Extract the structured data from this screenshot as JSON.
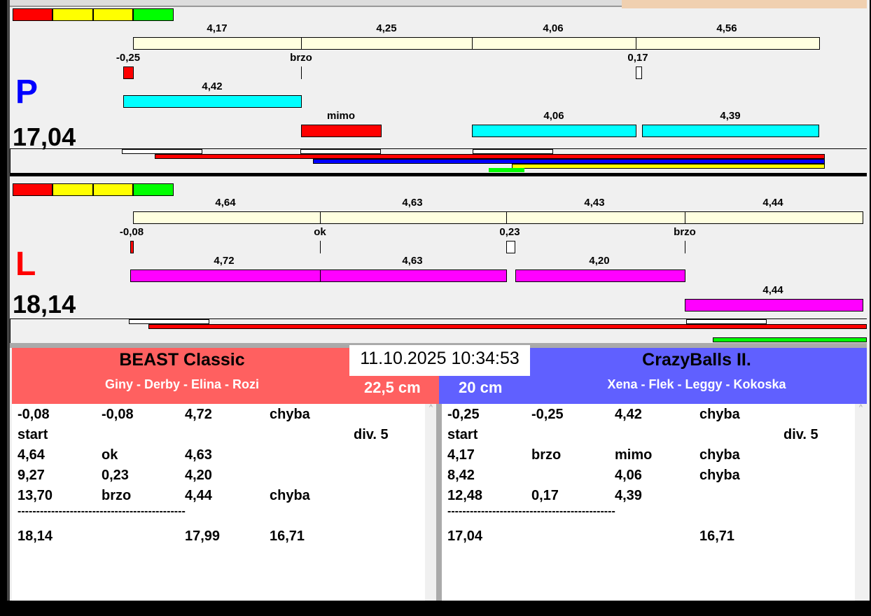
{
  "colors": {
    "red": "#ff0000",
    "yellow": "#ffff00",
    "green": "#00ff00",
    "cream": "#ffffe0",
    "cyan": "#00ffff",
    "magenta": "#ff00ff",
    "blue": "#0000ff",
    "team_left": "#ff6060",
    "team_right": "#6060ff"
  },
  "panel_p": {
    "letter": "P",
    "total": "17,04",
    "top_labels": [
      "4,17",
      "4,25",
      "4,06",
      "4,56"
    ],
    "mid_labels": [
      "-0,25",
      "brzo",
      "0,17"
    ],
    "cyan1_label": "4,42",
    "row2_labels": [
      "mimo",
      "4,06",
      "4,39"
    ]
  },
  "panel_l": {
    "letter": "L",
    "total": "18,14",
    "top_labels": [
      "4,64",
      "4,63",
      "4,43",
      "4,44"
    ],
    "mid_labels": [
      "-0,08",
      "ok",
      "0,23",
      "brzo"
    ],
    "mag_labels": [
      "4,72",
      "4,63",
      "4,20"
    ],
    "mag2_label": "4,44"
  },
  "datetime": "11.10.2025 10:34:53",
  "left_team": {
    "name": "BEAST Classic",
    "members": "Giny - Derby - Elina - Rozi",
    "distance": "22,5 cm",
    "rows": [
      [
        "-0,08",
        "-0,08",
        "4,72",
        "chyba",
        ""
      ],
      [
        "start",
        "",
        "",
        "",
        "div.  5"
      ],
      [
        "4,64",
        "ok",
        "4,63",
        "",
        ""
      ],
      [
        "9,27",
        "0,23",
        "4,20",
        "",
        ""
      ],
      [
        "13,70",
        "brzo",
        "4,44",
        "chyba",
        ""
      ]
    ],
    "divider": "---------------------------------------------",
    "totals": [
      "18,14",
      "",
      "17,99",
      "16,71",
      ""
    ]
  },
  "right_team": {
    "name": "CrazyBalls II.",
    "members": "Xena - Flek - Leggy - Kokoska",
    "distance": "20 cm",
    "rows": [
      [
        "-0,25",
        "-0,25",
        "4,42",
        "chyba",
        ""
      ],
      [
        "start",
        "",
        "",
        "",
        "div.  5"
      ],
      [
        "4,17",
        "brzo",
        "mimo",
        "chyba",
        ""
      ],
      [
        "8,42",
        "",
        "4,06",
        "chyba",
        ""
      ],
      [
        "12,48",
        "0,17",
        "4,39",
        "",
        ""
      ]
    ],
    "divider": "---------------------------------------------",
    "totals": [
      "17,04",
      "",
      "",
      "16,71",
      ""
    ]
  }
}
